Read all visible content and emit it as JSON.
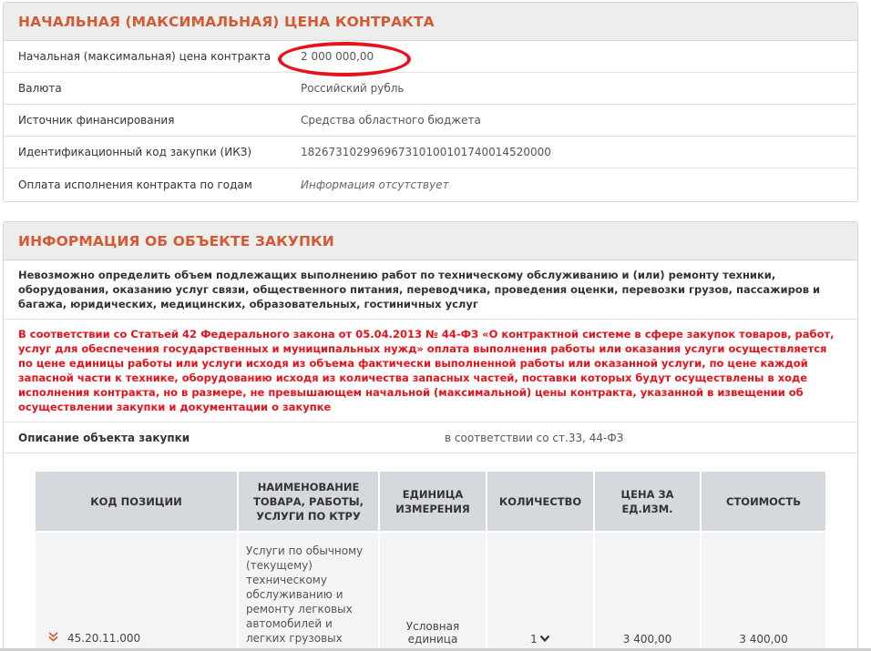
{
  "price_section": {
    "title": "НАЧАЛЬНАЯ (МАКСИМАЛЬНАЯ) ЦЕНА КОНТРАКТА",
    "rows": [
      {
        "label": "Начальная (максимальная) цена контракта",
        "value": "2 000 000,00"
      },
      {
        "label": "Валюта",
        "value": "Российский рубль"
      },
      {
        "label": "Источник финансирования",
        "value": "Средства областного бюджета"
      },
      {
        "label": "Идентификационный код закупки (ИКЗ)",
        "value": "182673102996967310100101740014520000"
      },
      {
        "label": "Оплата исполнения контракта по годам",
        "value": "Информация отсутствует"
      }
    ],
    "highlight_color": "#e8121c"
  },
  "object_section": {
    "title": "ИНФОРМАЦИЯ ОБ ОБЪЕКТЕ ЗАКУПКИ",
    "notice_bold": "Невозможно определить объем подлежащих выполнению работ по техническому обслуживанию и (или) ремонту техники, оборудования, оказанию услуг связи, общественного питания, переводчика, проведения оценки, перевозки грузов, пассажиров и багажа, юридических, медицинских, образовательных, гостиничных услуг",
    "notice_red": "В соответствии со Статьей 42 Федерального закона от 05.04.2013 № 44-ФЗ «О контрактной системе в сфере закупок товаров, работ, услуг для обеспечения государственных и муниципальных нужд» оплата выполнения работы или оказания услуги осуществляется по цене единицы работы или услуги исходя из объема фактически выполненной работы или оказанной услуги, по цене каждой запасной части к технике, оборудованию исходя из количества запасных частей, поставки которых будут осуществлены в ходе исполнения контракта, но в размере, не превышающем начальной (максимальной) цены контракта, указанной в извещении об осуществлении закупки и документации о закупке",
    "description_label": "Описание объекта закупки",
    "description_value": "в соответствии со ст.33, 44-ФЗ",
    "table": {
      "headers": [
        "КОД ПОЗИЦИИ",
        "НАИМЕНОВАНИЕ ТОВАРА, РАБОТЫ, УСЛУГИ ПО КТРУ",
        "ЕДИНИЦА ИЗМЕРЕНИЯ",
        "КОЛИЧЕСТВО",
        "ЦЕНА ЗА ЕД.ИЗМ.",
        "СТОИМОСТЬ"
      ],
      "rows": [
        {
          "code": "45.20.11.000",
          "name": "Услуги по обычному (текущему) техническому обслуживанию и ремонту легковых автомобилей и легких грузовых",
          "unit": "Условная единица",
          "quantity": "1",
          "price": "3 400,00",
          "cost": "3 400,00"
        }
      ]
    }
  },
  "colors": {
    "accent": "#d35a32",
    "header_bg": "#eceded",
    "table_header_bg": "#d5d8dc",
    "alert_red": "#e8121c"
  },
  "icons": {
    "expand": "double-chevron-down-icon",
    "quantity_toggle": "chevron-down-icon"
  }
}
